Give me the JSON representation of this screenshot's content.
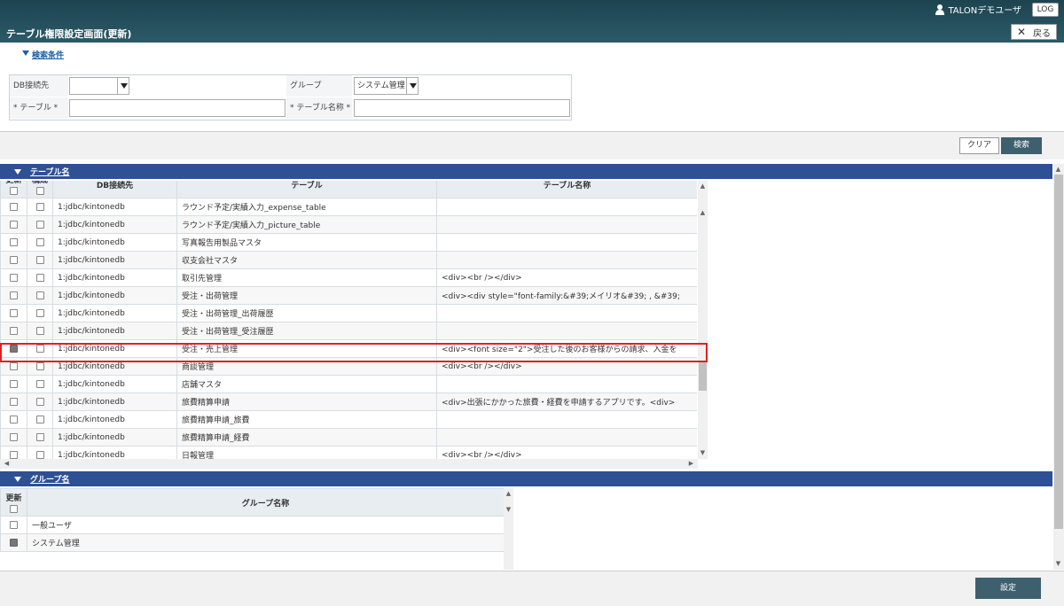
{
  "header": {
    "user": "TALONデモユーザ",
    "log_label": "LOG",
    "page_title": "テーブル権限設定画面(更新)",
    "back_label": "戻る"
  },
  "search": {
    "toggle_label": "検索条件",
    "db_label": "DB接続先",
    "db_value": "",
    "group_label": "グループ",
    "group_value": "システム管理",
    "table_label": "* テーブル *",
    "table_value": "",
    "table_name_label": "* テーブル名称 *",
    "table_name_value": ""
  },
  "buttons": {
    "clear": "クリア",
    "search": "検索",
    "set": "設定"
  },
  "tables_section": {
    "title": "テーブル名",
    "headers": {
      "update": "更新",
      "config": "構成",
      "db": "DB接続先",
      "table": "テーブル",
      "table_name": "テーブル名称"
    },
    "rows": [
      {
        "update": false,
        "config": false,
        "db": "1:jdbc/kintonedb",
        "table": "ラウンド予定/実績入力_expense_table",
        "name": ""
      },
      {
        "update": false,
        "config": false,
        "db": "1:jdbc/kintonedb",
        "table": "ラウンド予定/実績入力_picture_table",
        "name": ""
      },
      {
        "update": false,
        "config": false,
        "db": "1:jdbc/kintonedb",
        "table": "写真報告用製品マスタ",
        "name": ""
      },
      {
        "update": false,
        "config": false,
        "db": "1:jdbc/kintonedb",
        "table": "収支会社マスタ",
        "name": ""
      },
      {
        "update": false,
        "config": false,
        "db": "1:jdbc/kintonedb",
        "table": "取引先管理",
        "name": "<div><br /></div>"
      },
      {
        "update": false,
        "config": false,
        "db": "1:jdbc/kintonedb",
        "table": "受注・出荷管理",
        "name": "<div><div style=\"font-family:&#39;メイリオ&#39; , &#39;"
      },
      {
        "update": false,
        "config": false,
        "db": "1:jdbc/kintonedb",
        "table": "受注・出荷管理_出荷履歴",
        "name": ""
      },
      {
        "update": false,
        "config": false,
        "db": "1:jdbc/kintonedb",
        "table": "受注・出荷管理_受注履歴",
        "name": ""
      },
      {
        "update": true,
        "config": false,
        "db": "1:jdbc/kintonedb",
        "table": "受注・売上管理",
        "name": "<div><font size=\"2\">受注した後のお客様からの請求、入金を"
      },
      {
        "update": false,
        "config": false,
        "db": "1:jdbc/kintonedb",
        "table": "商談管理",
        "name": "<div><br /></div>"
      },
      {
        "update": false,
        "config": false,
        "db": "1:jdbc/kintonedb",
        "table": "店舗マスタ",
        "name": ""
      },
      {
        "update": false,
        "config": false,
        "db": "1:jdbc/kintonedb",
        "table": "旅費精算申請",
        "name": "<div>出張にかかった旅費・経費を申請するアプリです。<div>"
      },
      {
        "update": false,
        "config": false,
        "db": "1:jdbc/kintonedb",
        "table": "旅費精算申請_旅費",
        "name": ""
      },
      {
        "update": false,
        "config": false,
        "db": "1:jdbc/kintonedb",
        "table": "旅費精算申請_経費",
        "name": ""
      },
      {
        "update": false,
        "config": false,
        "db": "1:jdbc/kintonedb",
        "table": "日報管理",
        "name": "<div><br /></div>"
      }
    ]
  },
  "groups_section": {
    "title": "グループ名",
    "headers": {
      "update": "更新",
      "group_name": "グループ名称"
    },
    "rows": [
      {
        "update": false,
        "name": "一般ユーザ"
      },
      {
        "update": true,
        "name": "システム管理"
      }
    ]
  }
}
